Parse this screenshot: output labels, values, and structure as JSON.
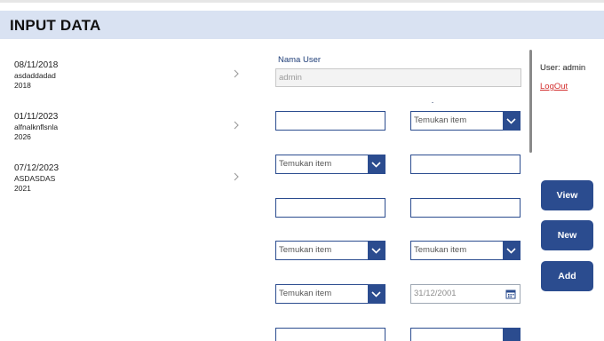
{
  "header": {
    "title": "INPUT DATA"
  },
  "gallery": {
    "items": [
      {
        "date": "08/11/2018",
        "name": "asdaddadad",
        "year": "2018"
      },
      {
        "date": "01/11/2023",
        "name": "alfnalknflsnla",
        "year": "2026"
      },
      {
        "date": "07/12/2023",
        "name": "ASDASDAS",
        "year": "2021"
      }
    ]
  },
  "form": {
    "user_label": "Nama User",
    "user_value": "admin",
    "dropdown_placeholder": "Temukan item",
    "date_value": "31/12/2001"
  },
  "sidebar": {
    "user_text": "User: admin",
    "logout_label": "LogOut",
    "buttons": {
      "view": "View",
      "new": "New",
      "add": "Add"
    }
  },
  "colors": {
    "primary": "#2b4c8f",
    "header_bg": "#d9e2f2",
    "logout": "#d32f2f"
  }
}
